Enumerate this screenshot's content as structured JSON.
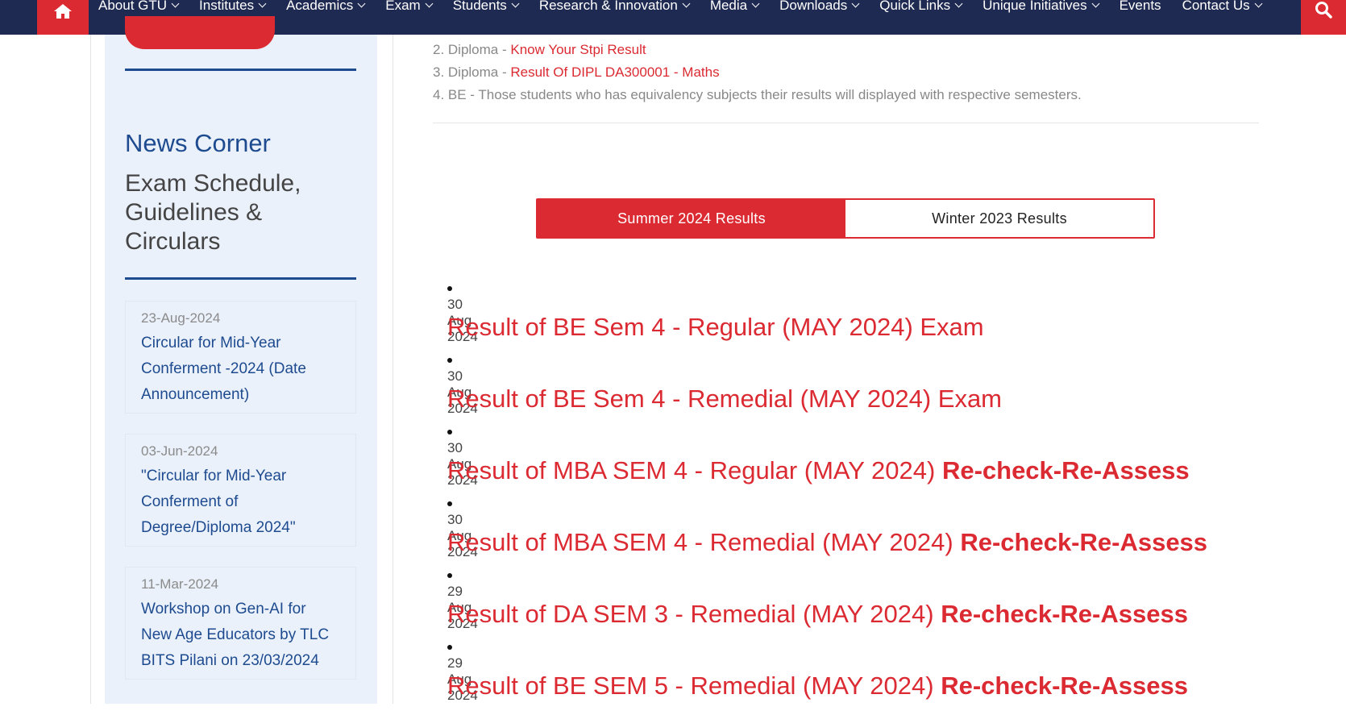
{
  "nav": {
    "items": [
      {
        "label": "About GTU"
      },
      {
        "label": "Institutes"
      },
      {
        "label": "Academics"
      },
      {
        "label": "Exam"
      },
      {
        "label": "Students"
      },
      {
        "label": "Research & Innovation"
      },
      {
        "label": "Media"
      },
      {
        "label": "Downloads"
      },
      {
        "label": "Quick Links"
      },
      {
        "label": "Unique Initiatives"
      },
      {
        "label": "Events"
      },
      {
        "label": "Contact Us"
      }
    ]
  },
  "sidebar": {
    "title": "News Corner",
    "subtitle": "Exam Schedule, Guidelines & Circulars",
    "news": [
      {
        "date": "23-Aug-2024",
        "text": "Circular for Mid-Year Conferment -2024 (Date Announcement)"
      },
      {
        "date": "03-Jun-2024",
        "text": "\"Circular for Mid-Year Conferment of Degree/Diploma 2024\""
      },
      {
        "date": "11-Mar-2024",
        "text": "Workshop on Gen-AI for New Age Educators by TLC BITS Pilani on 23/03/2024"
      }
    ]
  },
  "notes": [
    {
      "prefix": "2. Diploma - ",
      "link": "Know Your Stpi Result"
    },
    {
      "prefix": "3. Diploma - ",
      "link": "Result Of DIPL DA300001 - Maths"
    },
    {
      "prefix": "4. BE - Those students who has equivalency subjects their results will displayed with respective semesters.",
      "link": ""
    }
  ],
  "tabs": {
    "active": "Summer 2024 Results",
    "inactive": "Winter 2023 Results"
  },
  "results": [
    {
      "date": "30 Aug 2024",
      "title": "Result of BE Sem 4 - Regular (MAY 2024) Exam",
      "extra": ""
    },
    {
      "date": "30 Aug 2024",
      "title": "Result of BE Sem 4 - Remedial (MAY 2024) Exam",
      "extra": ""
    },
    {
      "date": "30 Aug 2024",
      "title": "Result of MBA SEM 4 - Regular (MAY 2024) ",
      "extra": "Re-check-Re-Assess"
    },
    {
      "date": "30 Aug 2024",
      "title": "Result of MBA SEM 4 - Remedial (MAY 2024) ",
      "extra": "Re-check-Re-Assess"
    },
    {
      "date": "29 Aug 2024",
      "title": "Result of DA SEM 3 - Remedial (MAY 2024) ",
      "extra": "Re-check-Re-Assess"
    },
    {
      "date": "29 Aug 2024",
      "title": "Result of BE SEM 5 - Remedial (MAY 2024) ",
      "extra": "Re-check-Re-Assess"
    }
  ]
}
